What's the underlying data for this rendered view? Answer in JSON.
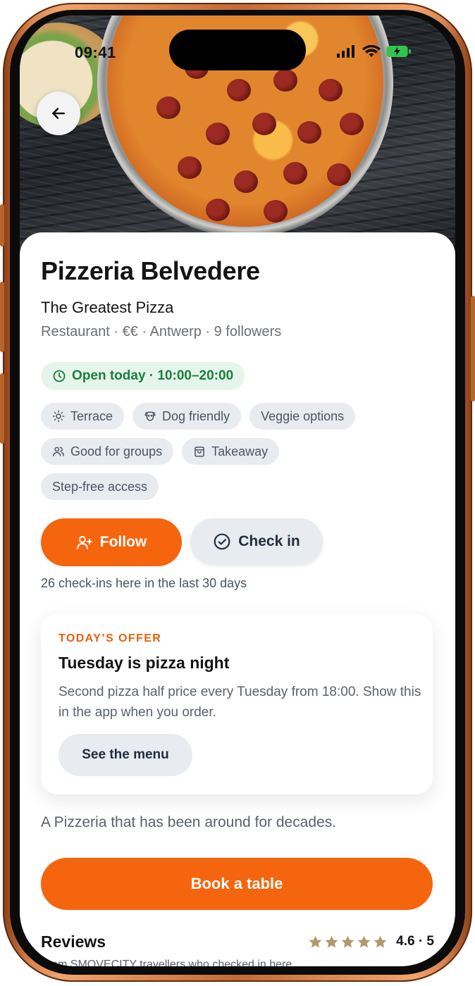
{
  "status_bar": {
    "time": "09:41"
  },
  "restaurant": {
    "name": "Pizzeria Belvedere",
    "tagline": "The Greatest Pizza",
    "meta": "Restaurant · €€ · Antwerp · 9 followers",
    "hours": "Open today · 10:00–20:00",
    "description": "A Pizzeria that has been around for decades."
  },
  "amenities": [
    {
      "label": "Terrace",
      "icon": "sun-icon"
    },
    {
      "label": "Dog friendly",
      "icon": "dog-icon"
    },
    {
      "label": "Veggie options",
      "icon": ""
    },
    {
      "label": "Good for groups",
      "icon": "users-icon"
    },
    {
      "label": "Takeaway",
      "icon": "bag-icon"
    },
    {
      "label": "Step-free access",
      "icon": ""
    }
  ],
  "actions": {
    "follow_label": "Follow",
    "checkin_label": "Check in",
    "checkins_note": "26 check-ins here in the last 30 days"
  },
  "offer": {
    "label": "TODAY’S OFFER",
    "title": "Tuesday is pizza night",
    "description": "Second pizza half price every Tuesday from 18:00. Show this in the app when you order.",
    "menu_button": "See the menu"
  },
  "booking": {
    "label": "Book a table"
  },
  "reviews": {
    "title": "Reviews",
    "rating_text": "4.6 · 5",
    "rating_value": 4.6,
    "rating_max": 5,
    "subtitle": "From SMOVECITY travellers who checked in here."
  },
  "colors": {
    "accent": "#f5650d",
    "open_green": "#1a7f3c",
    "star": "#b09a6a"
  }
}
